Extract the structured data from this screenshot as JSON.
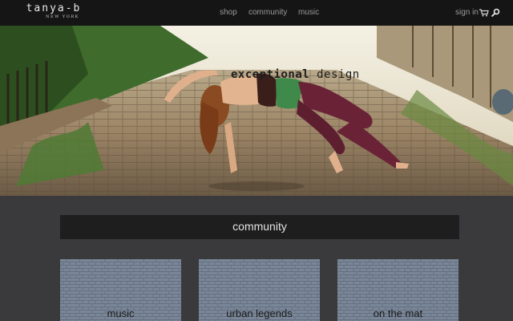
{
  "brand": {
    "name": "tanya-b",
    "location": "NEW YORK"
  },
  "nav": {
    "items": [
      {
        "label": "shop"
      },
      {
        "label": "community"
      },
      {
        "label": "music"
      }
    ],
    "sign_in": "sign in",
    "icons": [
      "cart-icon",
      "search-icon"
    ]
  },
  "hero": {
    "tagline_bold": "exceptional",
    "tagline_rest": " design"
  },
  "section": {
    "title": "community"
  },
  "cards": [
    {
      "label": "music"
    },
    {
      "label": "urban legends"
    },
    {
      "label": "on the mat"
    }
  ],
  "colors": {
    "topbar": "#151515",
    "page_background": "#3a3a3d",
    "section_bar": "#1e1e1f",
    "card_blue": "#6f7c8c"
  }
}
